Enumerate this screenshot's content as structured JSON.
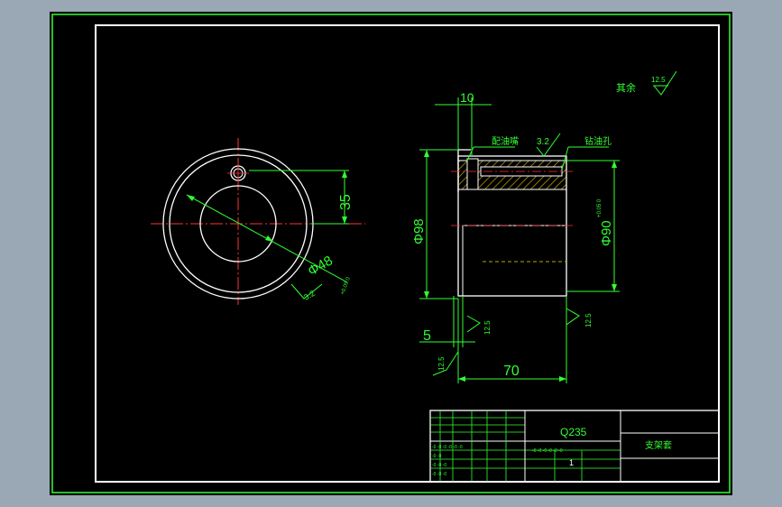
{
  "drawing": {
    "roughness_note": {
      "prefix": "其余",
      "value": "12.5"
    },
    "front_view": {
      "dim_offset": "35",
      "dim_hole": "Φ48",
      "dim_hole_tol": "+0.05 0",
      "dim_angle": "3.2"
    },
    "side_view": {
      "dim_top": "10",
      "label_grease": "配油嘴",
      "roughness_top": "3.2",
      "label_drill": "钻油孔",
      "dim_od_outer": "Φ98",
      "dim_od_inner": "Φ90",
      "dim_od_inner_tol": "+0.05 0",
      "roughness_right": "12.5",
      "roughness_left": "12.5",
      "roughness_bottom": "12.5",
      "dim_chamfer": "5",
      "dim_length": "70"
    },
    "title_block": {
      "material": "Q235",
      "part_name": "支架套",
      "scale": "1",
      "tiny_rows": [
        "-0 -0 -0 -0 -0 -0",
        "-0 -0",
        "-0 -0 -0",
        "-0 -0 -0"
      ]
    }
  },
  "colors": {
    "border": "#33ff33",
    "line": "#ffffff",
    "center": "#ff3333",
    "hatch": "#b8a400",
    "bg": "#000000"
  }
}
